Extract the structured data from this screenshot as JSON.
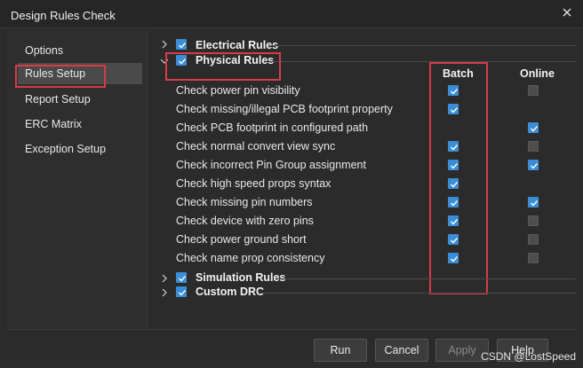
{
  "window": {
    "title": "Design Rules Check",
    "close_icon": "close-icon"
  },
  "sidebar": {
    "items": [
      {
        "label": "Options",
        "selected": false
      },
      {
        "label": "Rules Setup",
        "selected": true
      },
      {
        "label": "Report Setup",
        "selected": false
      },
      {
        "label": "ERC Matrix",
        "selected": false
      },
      {
        "label": "Exception Setup",
        "selected": false
      }
    ]
  },
  "sections": {
    "electrical": {
      "label": "Electrical Rules",
      "checked": true,
      "expanded": false
    },
    "physical": {
      "label": "Physical Rules",
      "checked": true,
      "expanded": true
    },
    "simulation": {
      "label": "Simulation Rules",
      "checked": true,
      "expanded": false
    },
    "custom": {
      "label": "Custom DRC",
      "checked": true,
      "expanded": false
    }
  },
  "columns": {
    "batch": "Batch",
    "online": "Online"
  },
  "rules": [
    {
      "label": "Check power pin visibility",
      "batch": true,
      "online": false
    },
    {
      "label": "Check missing/illegal PCB footprint property",
      "batch": true,
      "online": null
    },
    {
      "label": "Check PCB footprint in configured path",
      "batch": null,
      "online": true
    },
    {
      "label": "Check normal convert view sync",
      "batch": true,
      "online": false
    },
    {
      "label": "Check incorrect Pin Group assignment",
      "batch": true,
      "online": true
    },
    {
      "label": "Check high speed props syntax",
      "batch": true,
      "online": null
    },
    {
      "label": "Check missing pin numbers",
      "batch": true,
      "online": true
    },
    {
      "label": "Check device with zero pins",
      "batch": true,
      "online": false
    },
    {
      "label": "Check power ground short",
      "batch": true,
      "online": false
    },
    {
      "label": "Check name prop consistency",
      "batch": true,
      "online": false
    }
  ],
  "buttons": {
    "run": "Run",
    "cancel": "Cancel",
    "apply": "Apply",
    "help": "Help"
  },
  "watermark": "CSDN @LostSpeed",
  "colors": {
    "accent": "#3b8ed6",
    "annotation": "#d73b48"
  }
}
